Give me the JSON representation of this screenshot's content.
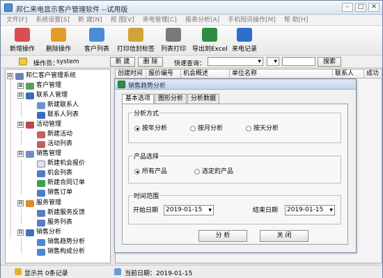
{
  "window": {
    "title": "邦仁来电显示客户管理软件 --试用版",
    "min": "–",
    "max": "□",
    "close": "✕"
  },
  "menu": [
    "文件[F]",
    "系统设置[S]",
    "新 建[N]",
    "视 图[V]",
    "来电管理[C]",
    "报表分析[A]",
    "手机短讯操作[M]",
    "帮 助[H]"
  ],
  "toolbar": [
    {
      "label": "新增操作",
      "icon": "add-user-icon",
      "color": "#d94e4e"
    },
    {
      "label": "删除操作",
      "icon": "delete-hand-icon",
      "color": "#e39b2c"
    },
    {
      "label": "客户列表",
      "icon": "customer-list-icon",
      "color": "#4c8bd6"
    },
    {
      "label": "打印信封标签",
      "icon": "envelope-print-icon",
      "color": "#d2a33a"
    },
    {
      "label": "列表打印",
      "icon": "printer-icon",
      "color": "#7a7a7a"
    },
    {
      "label": "导出到Excel",
      "icon": "excel-export-icon",
      "color": "#2f8d3f"
    },
    {
      "label": "来电记录",
      "icon": "phone-record-icon",
      "color": "#2b6fcd"
    }
  ],
  "subbar": {
    "operator_label": "操作员：",
    "operator": "system",
    "new_btn": "新 建",
    "delete_btn": "删 除",
    "quick_query": "快速查询：",
    "search_btn": "搜索"
  },
  "tree": [
    {
      "label": "邦仁客户管理系统",
      "icon": "#6c84b5",
      "exp": "⊟",
      "level": 0
    },
    {
      "label": "客户管理",
      "icon": "#58a062",
      "exp": "⊞",
      "level": 1
    },
    {
      "label": "联系人管理",
      "icon": "#3a6db8",
      "exp": "⊟",
      "level": 1
    },
    {
      "label": "新建联系人",
      "icon": "#6f93c9",
      "exp": "",
      "level": 2
    },
    {
      "label": "联系人列表",
      "icon": "#3a6db8",
      "exp": "",
      "level": 2
    },
    {
      "label": "活动管理",
      "icon": "#b84a4a",
      "exp": "⊟",
      "level": 1
    },
    {
      "label": "新建活动",
      "icon": "#c85e5e",
      "exp": "",
      "level": 2
    },
    {
      "label": "活动列表",
      "icon": "#c85e5e",
      "exp": "",
      "level": 2
    },
    {
      "label": "销售管理",
      "icon": "#6b8ec9",
      "exp": "⊟",
      "level": 1
    },
    {
      "label": "新建机会报价",
      "icon": "#e0e4ee",
      "exp": "",
      "level": 2
    },
    {
      "label": "机会列表",
      "icon": "#4e7ec4",
      "exp": "",
      "level": 2
    },
    {
      "label": "新建合同订单",
      "icon": "#39a34a",
      "exp": "",
      "level": 2
    },
    {
      "label": "销售订单",
      "icon": "#4a7fd0",
      "exp": "",
      "level": 2
    },
    {
      "label": "服务管理",
      "icon": "#d88d2d",
      "exp": "⊟",
      "level": 1
    },
    {
      "label": "新建服务反馈",
      "icon": "#5b7cc2",
      "exp": "",
      "level": 2
    },
    {
      "label": "服务列表",
      "icon": "#5b7cc2",
      "exp": "",
      "level": 2
    },
    {
      "label": "销售分析",
      "icon": "#3e72b9",
      "exp": "⊟",
      "level": 1
    },
    {
      "label": "销售趋势分析",
      "icon": "#4f87cf",
      "exp": "",
      "level": 2
    },
    {
      "label": "销售构成分析",
      "icon": "#4f87cf",
      "exp": "",
      "level": 2
    }
  ],
  "grid": {
    "columns": [
      "创建时间",
      "报价编号",
      "机会概述",
      "单位名称",
      "联系人",
      "成功"
    ]
  },
  "dialog": {
    "title": "销售趋势分析",
    "tabs": [
      "基本选项",
      "图形分析",
      "分析数据"
    ],
    "analysis_mode": {
      "title": "分析方式",
      "options": [
        "按年分析",
        "按月分析",
        "按天分析"
      ],
      "selected": 0
    },
    "product_select": {
      "title": "产品选择",
      "options": [
        "所有产品",
        "选定的产品"
      ],
      "selected": 0
    },
    "time_range": {
      "title": "时间范围",
      "start_label": "开始日期",
      "start_value": "2019-01-15",
      "end_label": "结束日期",
      "end_value": "2019-01-15"
    },
    "analyze_btn": "分 析",
    "close_btn": "关 闭"
  },
  "status": {
    "records": "显示共 0条记录",
    "current_date": "当前日期：2019-01-15"
  }
}
